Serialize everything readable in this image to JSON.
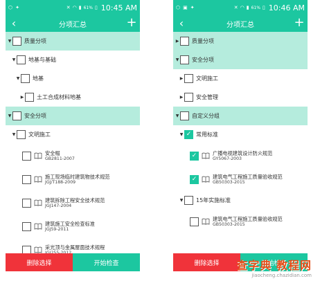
{
  "colors": {
    "accent": "#1cc7a0",
    "group_bg": "#b5ecdd",
    "danger": "#f0333a"
  },
  "status": {
    "battery": "61%",
    "time": "10:45 AM"
  },
  "status_right": {
    "battery": "61%",
    "time": "10:46 AM"
  },
  "app_title": "分项汇总",
  "left": {
    "nodes": [
      {
        "label": "质量分项"
      },
      {
        "label": "地基与基础"
      },
      {
        "label": "地基"
      },
      {
        "label": "土工合成材料地基"
      },
      {
        "label": "安全分项"
      },
      {
        "label": "文明施工"
      }
    ],
    "leaves": [
      {
        "title": "安全帽",
        "code": "GB2811-2007"
      },
      {
        "title": "施工现场临时建筑物技术规范",
        "code": "JGJ/T188-2009"
      },
      {
        "title": "建筑拆除工程安全技术规范",
        "code": "JGJ147-2004"
      },
      {
        "title": "建筑施工安全检查标准",
        "code": "JGJ59-2011"
      },
      {
        "title": "采光顶与金属屋面技术规程",
        "code": "JGJ255-2012"
      }
    ],
    "buttons": {
      "delete": "删除选择",
      "start": "开始检查"
    }
  },
  "right": {
    "nodes": [
      {
        "label": "质量分项"
      },
      {
        "label": "安全分项"
      },
      {
        "label": "文明施工"
      },
      {
        "label": "安全管理"
      },
      {
        "label": "自定义分组"
      },
      {
        "label": "常用标准"
      },
      {
        "label": "15年实施标准"
      }
    ],
    "leaves": [
      {
        "title": "广播电视建筑设计防火规范",
        "code": "GY5067-2003"
      },
      {
        "title": "建筑电气工程施工质量验收规范",
        "code": "GB50303-2015"
      },
      {
        "title": "建筑电气工程施工质量验收规范",
        "code": "GB50303-2015"
      }
    ],
    "buttons": {
      "delete": "删除选择",
      "start": "开始检查"
    }
  },
  "watermark": {
    "main": "查字典 教程网",
    "sub": "jiaocheng.chazidian.com"
  }
}
